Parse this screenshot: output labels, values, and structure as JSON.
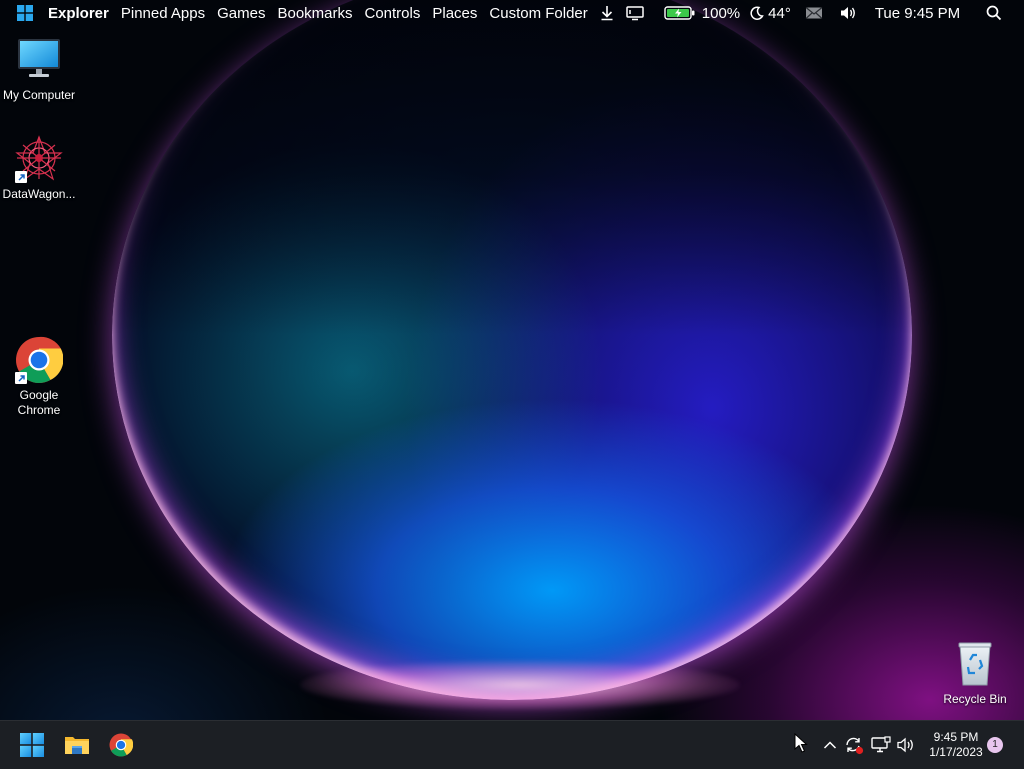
{
  "menubar": {
    "items": [
      {
        "label": "Explorer"
      },
      {
        "label": "Pinned Apps"
      },
      {
        "label": "Games"
      },
      {
        "label": "Bookmarks"
      },
      {
        "label": "Controls"
      },
      {
        "label": "Places"
      },
      {
        "label": "Custom Folder"
      }
    ],
    "status": {
      "battery": "100%",
      "weather": "44°",
      "datetime": "Tue 9:45 PM"
    },
    "icons": [
      "windows-logo-icon",
      "download-icon",
      "display-icon",
      "battery-charging-icon",
      "moon-icon",
      "mail-icon",
      "volume-icon",
      "search-icon",
      "menu-list-icon"
    ]
  },
  "desktop": {
    "icons": [
      {
        "label": "My Computer",
        "icon": "monitor-icon"
      },
      {
        "label": "DataWagon...",
        "icon": "datawagon-icon"
      },
      {
        "label": "Google Chrome",
        "icon": "chrome-icon"
      },
      {
        "label": "Recycle Bin",
        "icon": "recycle-bin-icon"
      }
    ]
  },
  "taskbar": {
    "pinned": [
      "windows-start-icon",
      "file-explorer-icon",
      "chrome-icon"
    ],
    "tray_icons": [
      "chevron-up-icon",
      "sync-icon",
      "network-icon",
      "volume-icon"
    ],
    "clock_time": "9:45 PM",
    "clock_date": "1/17/2023",
    "notification_count": "1"
  },
  "colors": {
    "taskbar_bg": "#1c1f24",
    "windows_blue": "#1aa3e8",
    "battery_green": "#3cc94a",
    "sync_alert": "#e02020"
  }
}
